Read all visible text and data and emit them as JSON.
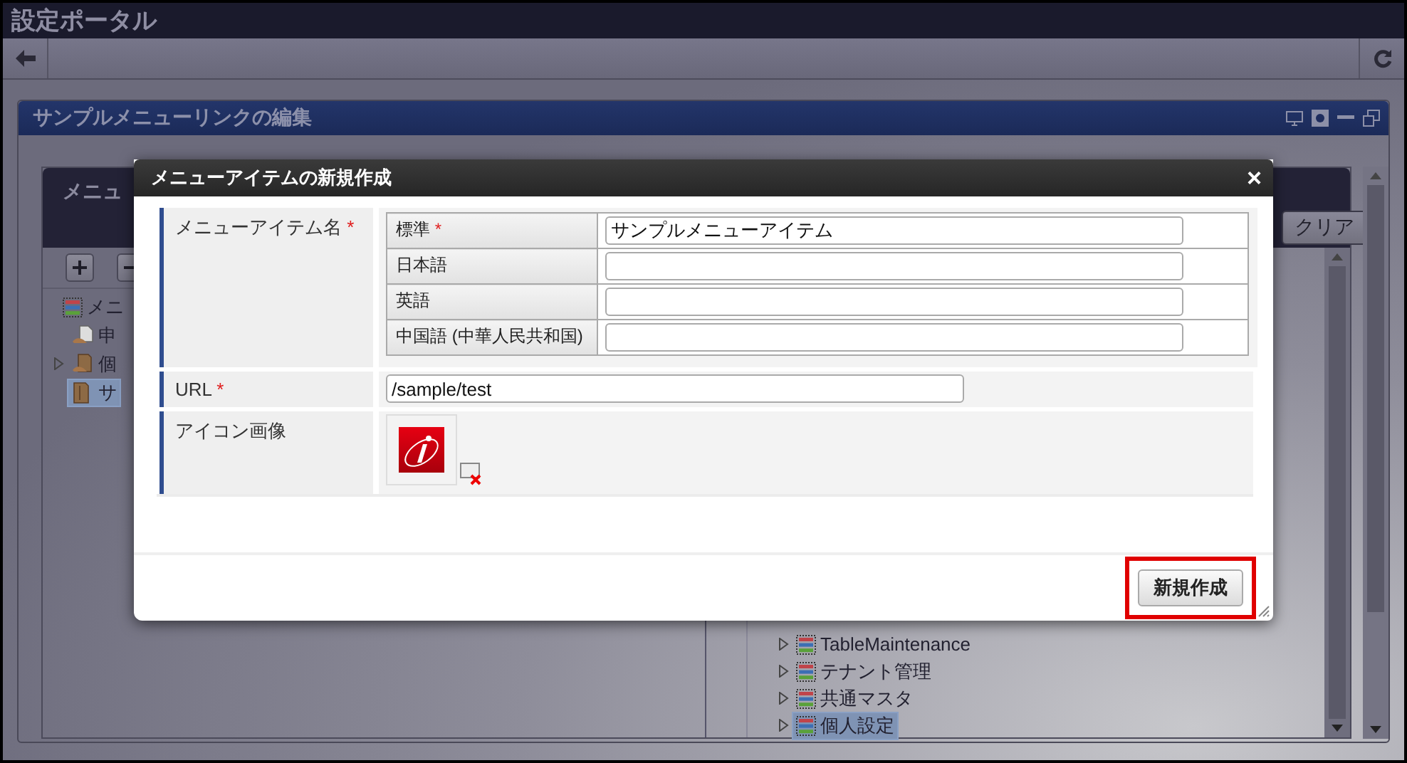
{
  "portal": {
    "title": "設定ポータル"
  },
  "panel": {
    "title": "サンプルメニューリンクの編集"
  },
  "editor": {
    "title": "メニュ",
    "clear_button": "クリア",
    "tree": [
      {
        "label": "メニ",
        "kind": "list",
        "selected": false,
        "children": [
          {
            "label": "申",
            "kind": "page",
            "selected": false
          },
          {
            "label": "個",
            "kind": "folder-user",
            "selected": false,
            "expanded": false
          },
          {
            "label": "サ",
            "kind": "folder",
            "selected": true
          }
        ]
      }
    ],
    "menu_list": [
      {
        "label": "TableMaintenance",
        "kind": "list",
        "selected": false,
        "expanded": false
      },
      {
        "label": "テナント管理",
        "kind": "list",
        "selected": false,
        "expanded": false
      },
      {
        "label": "共通マスタ",
        "kind": "list",
        "selected": false,
        "expanded": false
      },
      {
        "label": "個人設定",
        "kind": "list",
        "selected": true,
        "expanded": false
      }
    ]
  },
  "dialog": {
    "title": "メニューアイテムの新規作成",
    "close": "×",
    "fields": [
      {
        "label": "メニューアイテム名",
        "mark": "*",
        "kind": "locales",
        "locales": [
          {
            "label": "標準",
            "mark": "*",
            "value": "サンプルメニューアイテム"
          },
          {
            "label": "日本語"
          },
          {
            "label": "英語"
          },
          {
            "label": "中国語 (中華人民共和国)"
          }
        ]
      },
      {
        "label": "URL",
        "mark": "*",
        "kind": "text",
        "value": "/sample/test"
      },
      {
        "label": "アイコン画像",
        "kind": "image"
      }
    ],
    "submit": "新規作成",
    "highlighted": true
  }
}
